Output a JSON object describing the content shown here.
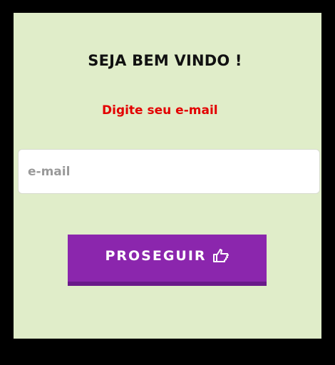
{
  "welcome": {
    "title": "SEJA BEM VINDO !",
    "prompt": "Digite seu e-mail"
  },
  "form": {
    "email_placeholder": "e-mail",
    "email_value": ""
  },
  "button": {
    "label": "PROSEGUIR",
    "icon": "pointing-hand-icon"
  },
  "colors": {
    "panel_bg": "#e0edc9",
    "prompt_text": "#e30000",
    "button_bg": "#8b26ad",
    "button_shadow": "#6a1a8a",
    "frame_bg": "#000000"
  }
}
